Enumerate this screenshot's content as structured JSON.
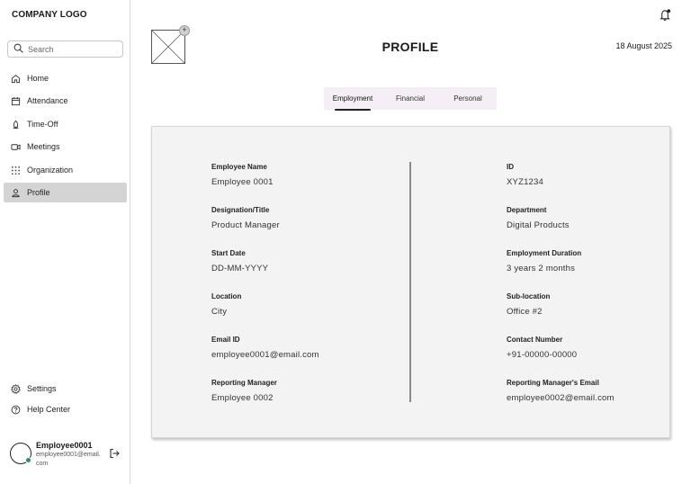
{
  "sidebar": {
    "logo": "COMPANY LOGO",
    "search_placeholder": "Search",
    "items": [
      {
        "label": "Home",
        "icon": "home-icon"
      },
      {
        "label": "Attendance",
        "icon": "calendar-icon"
      },
      {
        "label": "Time-Off",
        "icon": "time-off-icon"
      },
      {
        "label": "Meetings",
        "icon": "video-icon"
      },
      {
        "label": "Organization",
        "icon": "grid-icon"
      },
      {
        "label": "Profile",
        "icon": "user-icon",
        "active": true
      }
    ],
    "bottom_items": [
      {
        "label": "Settings",
        "icon": "gear-icon"
      },
      {
        "label": "Help Center",
        "icon": "help-icon"
      }
    ],
    "user": {
      "name": "Employee0001",
      "email": "employee0001@email.com",
      "status_color": "#1a9c4a"
    }
  },
  "header": {
    "title": "PROFILE",
    "date": "18 August 2025"
  },
  "tabs": [
    {
      "label": "Employment",
      "active": true
    },
    {
      "label": "Financial",
      "active": false
    },
    {
      "label": "Personal",
      "active": false
    }
  ],
  "profile": {
    "left": [
      {
        "label": "Employee Name",
        "value": "Employee 0001"
      },
      {
        "label": "Designation/Title",
        "value": "Product Manager"
      },
      {
        "label": "Start Date",
        "value": "DD-MM-YYYY"
      },
      {
        "label": "Location",
        "value": "City"
      },
      {
        "label": "Email ID",
        "value": "employee0001@email.com"
      },
      {
        "label": "Reporting Manager",
        "value": "Employee 0002"
      }
    ],
    "right": [
      {
        "label": "ID",
        "value": "XYZ1234"
      },
      {
        "label": "Department",
        "value": "Digital Products"
      },
      {
        "label": "Employment Duration",
        "value": "3 years 2 months"
      },
      {
        "label": "Sub-location",
        "value": "Office #2"
      },
      {
        "label": "Contact Number",
        "value": "+91-00000-00000"
      },
      {
        "label": "Reporting Manager's Email",
        "value": "employee0002@email.com"
      }
    ]
  },
  "colors": {
    "accent": "#f6eef6",
    "active_nav": "#d4d4d4",
    "card": "#f3f3f3"
  }
}
